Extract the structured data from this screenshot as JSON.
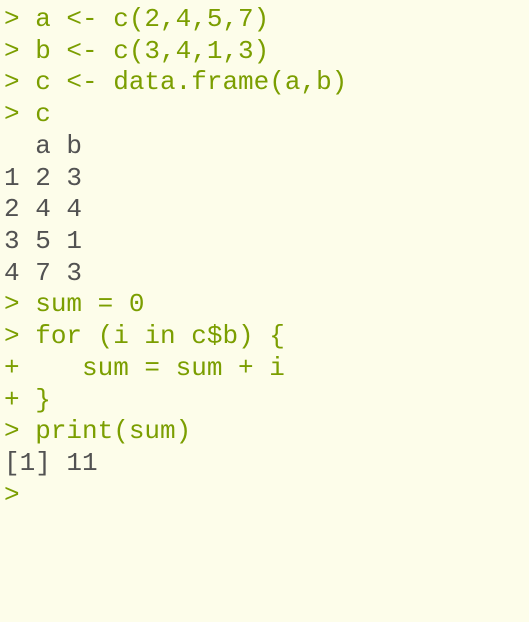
{
  "lines": [
    {
      "prompt": "> ",
      "code": "a <- c(2,4,5,7)"
    },
    {
      "prompt": "> ",
      "code": "b <- c(3,4,1,3)"
    },
    {
      "prompt": "> ",
      "code": "c <- data.frame(a,b)"
    },
    {
      "prompt": "> ",
      "code": "c"
    },
    {
      "output": "  a b"
    },
    {
      "output": "1 2 3"
    },
    {
      "output": "2 4 4"
    },
    {
      "output": "3 5 1"
    },
    {
      "output": "4 7 3"
    },
    {
      "prompt": "> ",
      "code": "sum = 0"
    },
    {
      "prompt": "> ",
      "code": "for (i in c$b) {"
    },
    {
      "prompt": "+ ",
      "code": "   sum = sum + i"
    },
    {
      "prompt": "+ ",
      "code": "}"
    },
    {
      "prompt": "> ",
      "code": "print(sum)"
    },
    {
      "output": "[1] 11"
    },
    {
      "prompt": "> ",
      "code": ""
    }
  ]
}
